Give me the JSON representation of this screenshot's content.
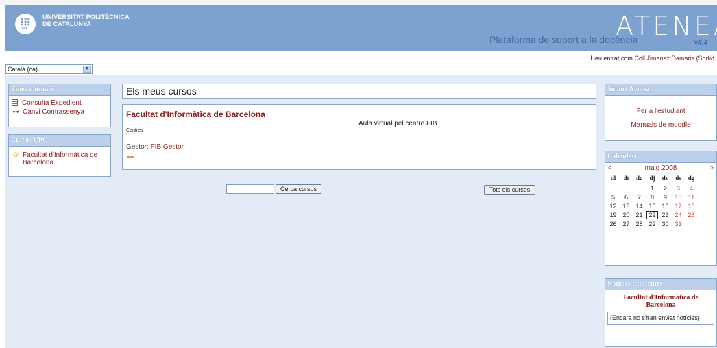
{
  "header": {
    "university_line1": "UNIVERSITAT POLITÈCNICA",
    "university_line2": "DE CATALUNYA",
    "logo_abbr": "UPC",
    "tagline": "Plataforma de suport a la docència",
    "brand": "ATENEA",
    "version": "v4.4"
  },
  "login": {
    "prefix": "Heu entrat com",
    "user": "Coll Jimenez Damaris",
    "logout": "(Sortid"
  },
  "language": {
    "selected": "Català (ca)"
  },
  "user_tools": {
    "title": "Eines d'usuari",
    "items": [
      {
        "label": "Consulta Expedient",
        "icon": "document-icon"
      },
      {
        "label": "Canvi Contrassenya",
        "icon": "key-icon"
      }
    ]
  },
  "upc_courses": {
    "title": "Cursos UPC",
    "items": [
      {
        "label_line1": "Facultat d'Informàtica de",
        "label_line2": "Barcelona",
        "icon": "people-icon"
      }
    ]
  },
  "main": {
    "title": "Els meus cursos",
    "course": {
      "name": "Facultat d'Informàtica de Barcelona",
      "description": "Aula virtual pel centre FIB",
      "category": "Centres",
      "manager_label": "Gestor:",
      "manager": "FIB Gestor"
    },
    "search_button": "Cerca cursos",
    "all_courses_button": "Tots els cursos"
  },
  "support": {
    "title": "Suport Atenea",
    "links": [
      "Per a l'estudiant",
      "Manuals de moodle"
    ]
  },
  "calendar": {
    "title": "Calendari",
    "prev": "<",
    "next": ">",
    "month": "maig 2008",
    "weekdays": [
      "dl",
      "dt",
      "dc",
      "dj",
      "dv",
      "ds",
      "dg"
    ],
    "weeks": [
      [
        "",
        "",
        "",
        "1",
        "2",
        "3",
        "4"
      ],
      [
        "5",
        "6",
        "7",
        "8",
        "9",
        "10",
        "11"
      ],
      [
        "12",
        "13",
        "14",
        "15",
        "16",
        "17",
        "18"
      ],
      [
        "19",
        "20",
        "21",
        "22",
        "23",
        "24",
        "25"
      ],
      [
        "26",
        "27",
        "28",
        "29",
        "30",
        "31",
        ""
      ]
    ],
    "today": "22",
    "weekend_color": "#cc3c3c"
  },
  "news": {
    "title": "Notícies del Centre",
    "center_line1": "Facultat d'Informàtica de",
    "center_line2": "Barcelona",
    "empty_text": "(Encara no s'han enviat notícies)"
  },
  "colors": {
    "header_bg": "#7da2cf",
    "page_bg": "#e3ebf6",
    "link": "#8a1e1e",
    "block_header": "#bcd0ec"
  }
}
